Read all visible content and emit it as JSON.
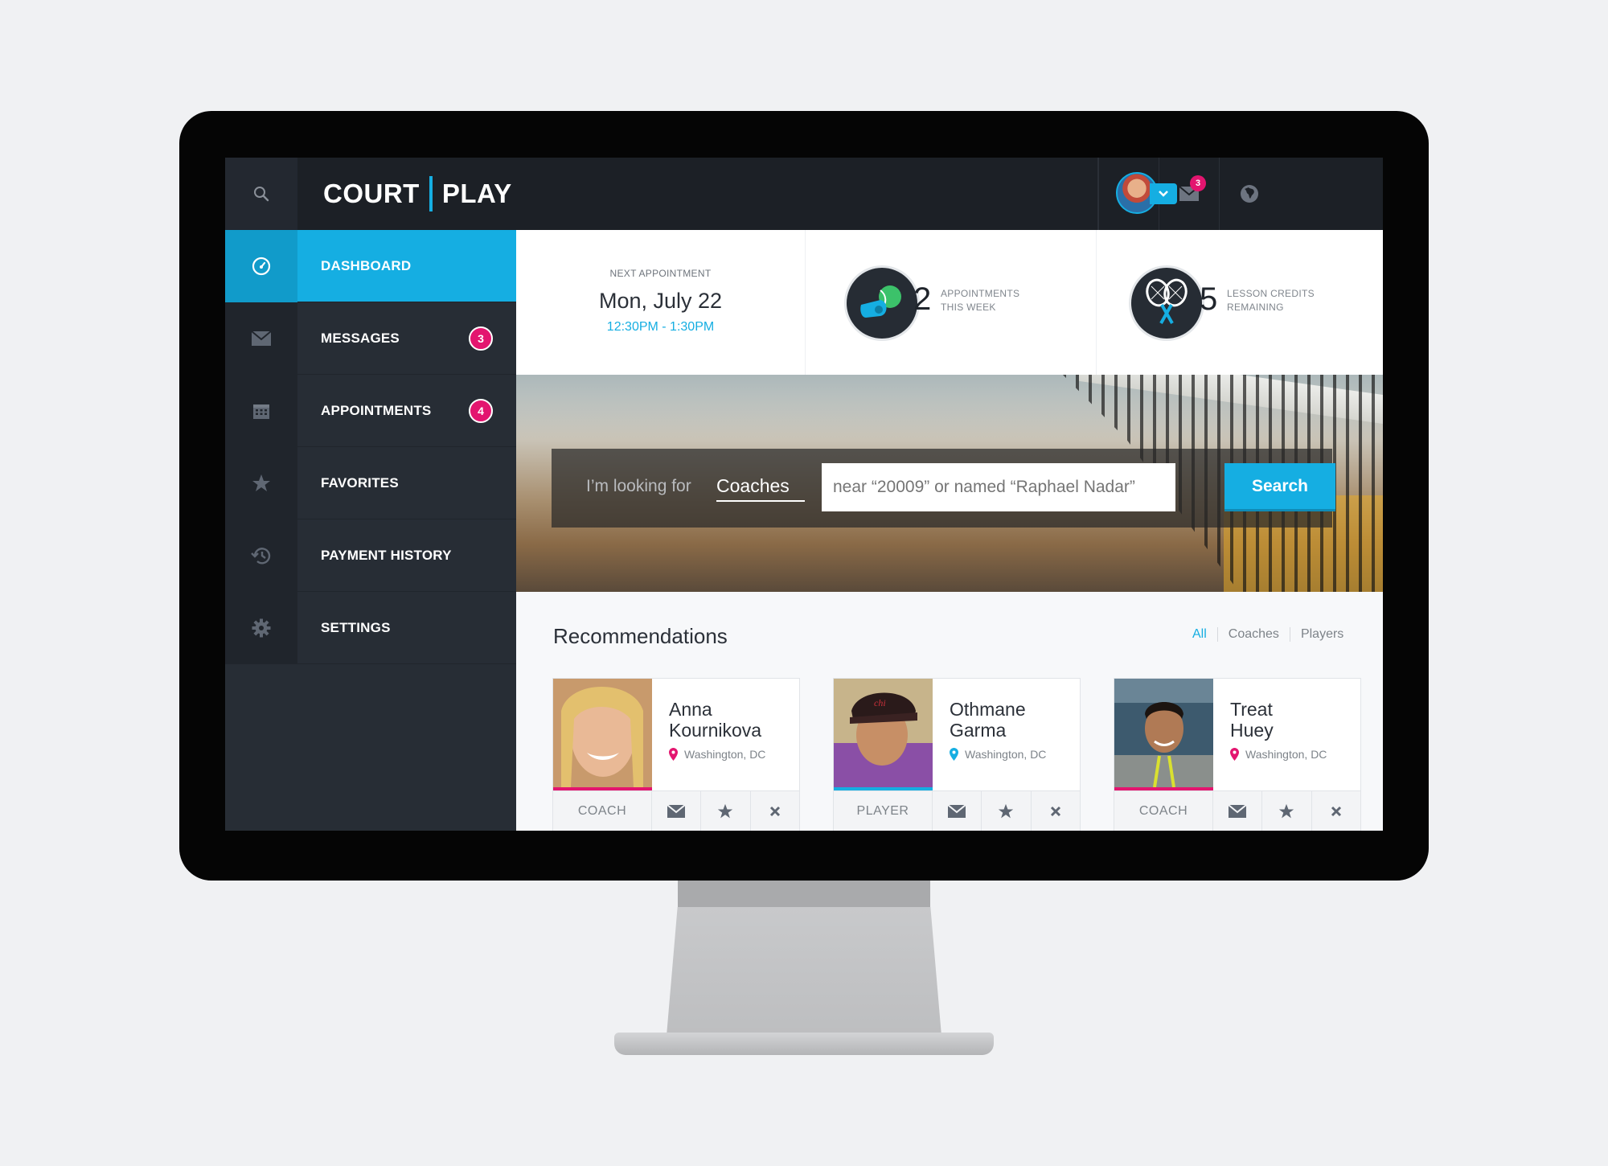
{
  "brand": {
    "left": "COURT",
    "right": "PLAY"
  },
  "topbar": {
    "messages_badge": "3"
  },
  "sidebar": {
    "items": [
      {
        "label": "DASHBOARD",
        "icon": "dashboard-icon",
        "active": true
      },
      {
        "label": "MESSAGES",
        "icon": "envelope-icon",
        "badge": "3"
      },
      {
        "label": "APPOINTMENTS",
        "icon": "calendar-icon",
        "badge": "4"
      },
      {
        "label": "FAVORITES",
        "icon": "star-icon"
      },
      {
        "label": "PAYMENT HISTORY",
        "icon": "history-icon"
      },
      {
        "label": "SETTINGS",
        "icon": "gear-icon"
      }
    ]
  },
  "stats": {
    "next_appointment": {
      "caption": "NEXT APPOINTMENT",
      "date": "Mon, July 22",
      "time": "12:30PM - 1:30PM"
    },
    "appointments": {
      "value": "2",
      "caption_line1": "APPOINTMENTS",
      "caption_line2": "THIS WEEK",
      "icon": "whistle-ball-icon"
    },
    "credits": {
      "value": "5",
      "caption_line1": "LESSON CREDITS",
      "caption_line2": "REMAINING",
      "icon": "rackets-icon"
    }
  },
  "search": {
    "prefix": "I’m looking for",
    "selected": "Coaches",
    "placeholder": "near “20009” or named “Raphael Nadar”",
    "button": "Search"
  },
  "recommendations": {
    "title": "Recommendations",
    "filters": [
      "All",
      "Coaches",
      "Players"
    ],
    "cards": [
      {
        "first": "Anna",
        "last": "Kournikova",
        "location": "Washington, DC",
        "role": "COACH"
      },
      {
        "first": "Othmane",
        "last": "Garma",
        "location": "Washington, DC",
        "role": "PLAYER"
      },
      {
        "first": "Treat",
        "last": "Huey",
        "location": "Washington, DC",
        "role": "COACH"
      }
    ]
  },
  "colors": {
    "accent": "#15aee2",
    "badge": "#e3156f",
    "sidebar": "#272d35",
    "topbar": "#1c2026"
  }
}
